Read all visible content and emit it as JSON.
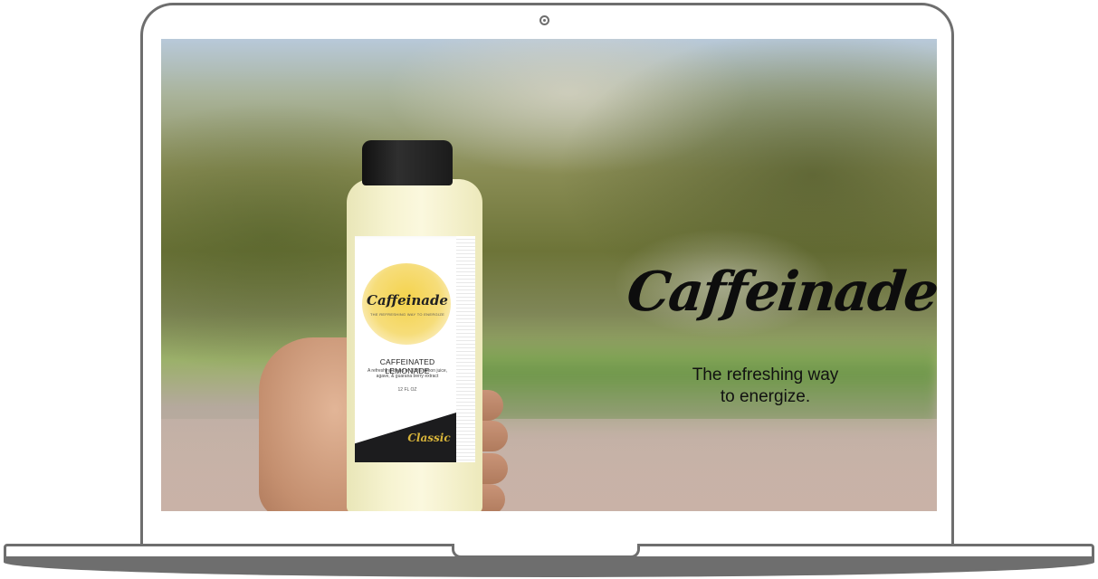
{
  "hero": {
    "brand_name": "Caffeinade",
    "tagline_line1": "The refreshing way",
    "tagline_line2": "to energize."
  },
  "product_label": {
    "brand": "Caffeinade",
    "tagline": "THE REFRESHING WAY TO ENERGIZE",
    "title": "CAFFEINATED LEMONADE",
    "description": "A refreshing blend of 100% lemon juice, agave, & guarana berry extract",
    "volume": "12 FL OZ",
    "variant": "Classic"
  },
  "colors": {
    "frame": "#6e6e6e",
    "label_band": "#1c1c1e",
    "variant_gold": "#d9b53a",
    "text": "#111111"
  }
}
